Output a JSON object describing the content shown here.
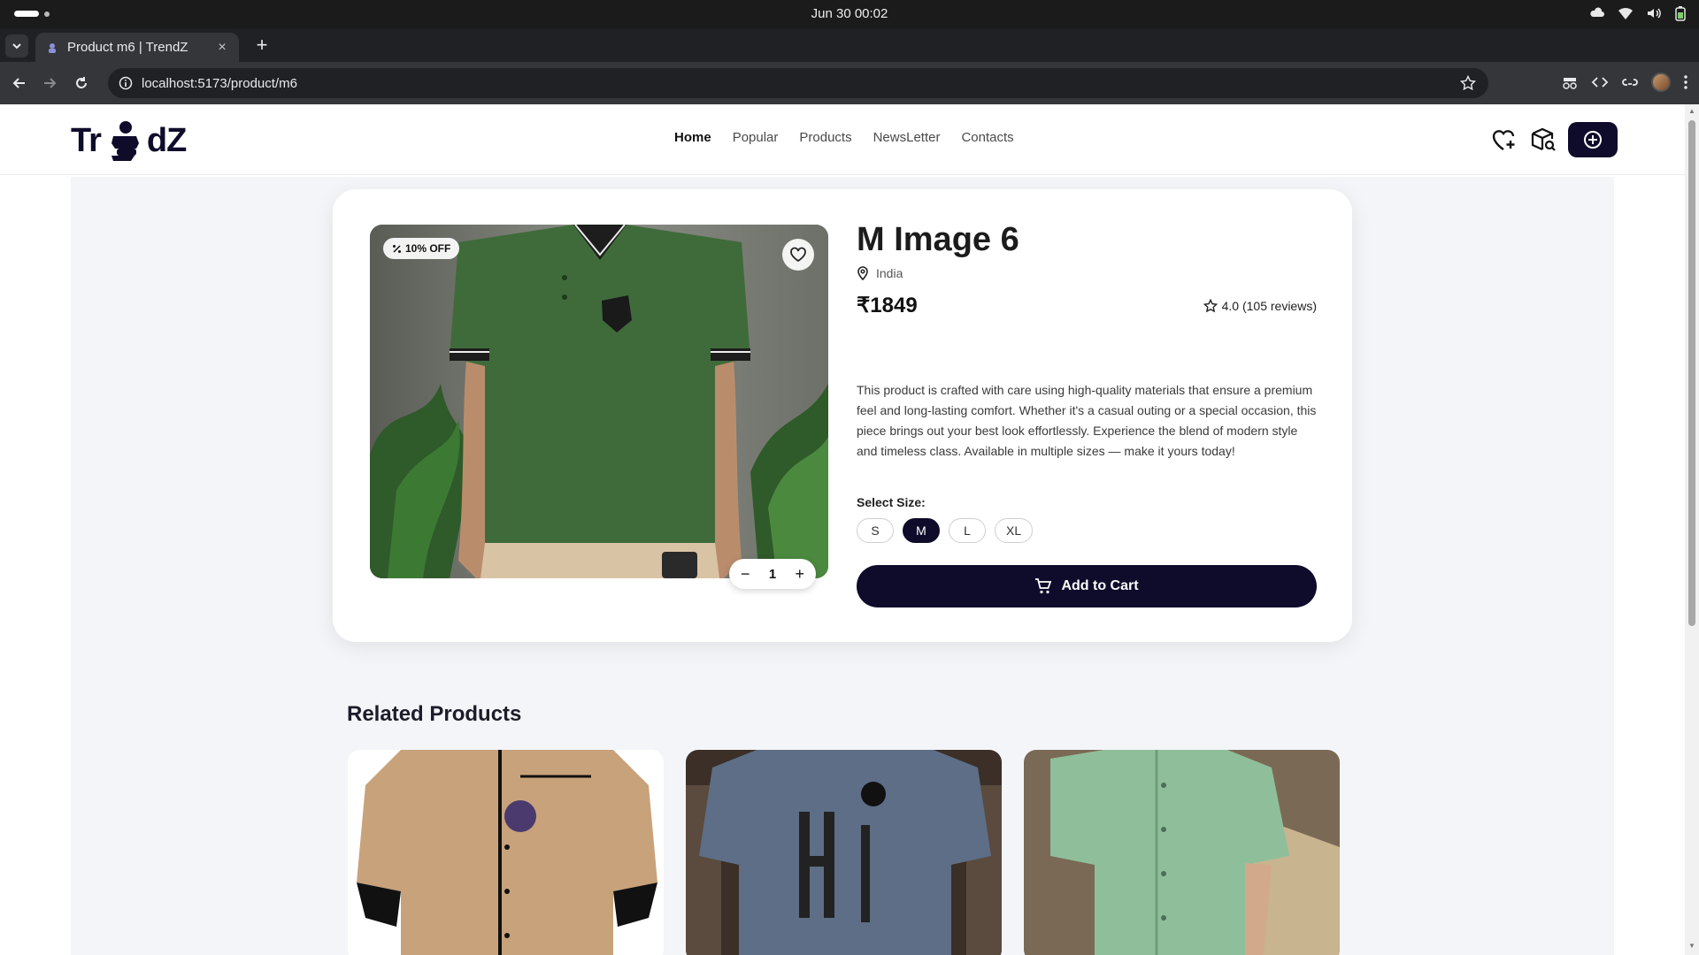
{
  "os": {
    "clock": "Jun 30  00:02"
  },
  "browser": {
    "tab_title": "Product m6 | TrendZ",
    "url": "localhost:5173/product/m6",
    "new_tab_label": "+",
    "close_label": "×"
  },
  "site": {
    "logo_left": "Tr",
    "logo_right": "dZ",
    "nav": [
      "Home",
      "Popular",
      "Products",
      "NewsLetter",
      "Contacts"
    ],
    "active_nav": "Home"
  },
  "product": {
    "discount": "10% OFF",
    "title": "M Image 6",
    "location": "India",
    "price": "₹1849",
    "rating": "4.0 (105 reviews)",
    "description": "This product is crafted with care using high-quality materials that ensure a premium feel and long-lasting comfort. Whether it's a casual outing or a special occasion, this piece brings out your best look effortlessly. Experience the blend of modern style and timeless class. Available in multiple sizes — make it yours today!",
    "size_label": "Select Size:",
    "sizes": [
      "S",
      "M",
      "L",
      "XL"
    ],
    "selected_size": "M",
    "quantity": "1",
    "add_to_cart": "Add to Cart"
  },
  "related": {
    "title": "Related Products"
  },
  "colors": {
    "brand": "#0f0b2b",
    "shirt_green": "#3f6b3a"
  }
}
